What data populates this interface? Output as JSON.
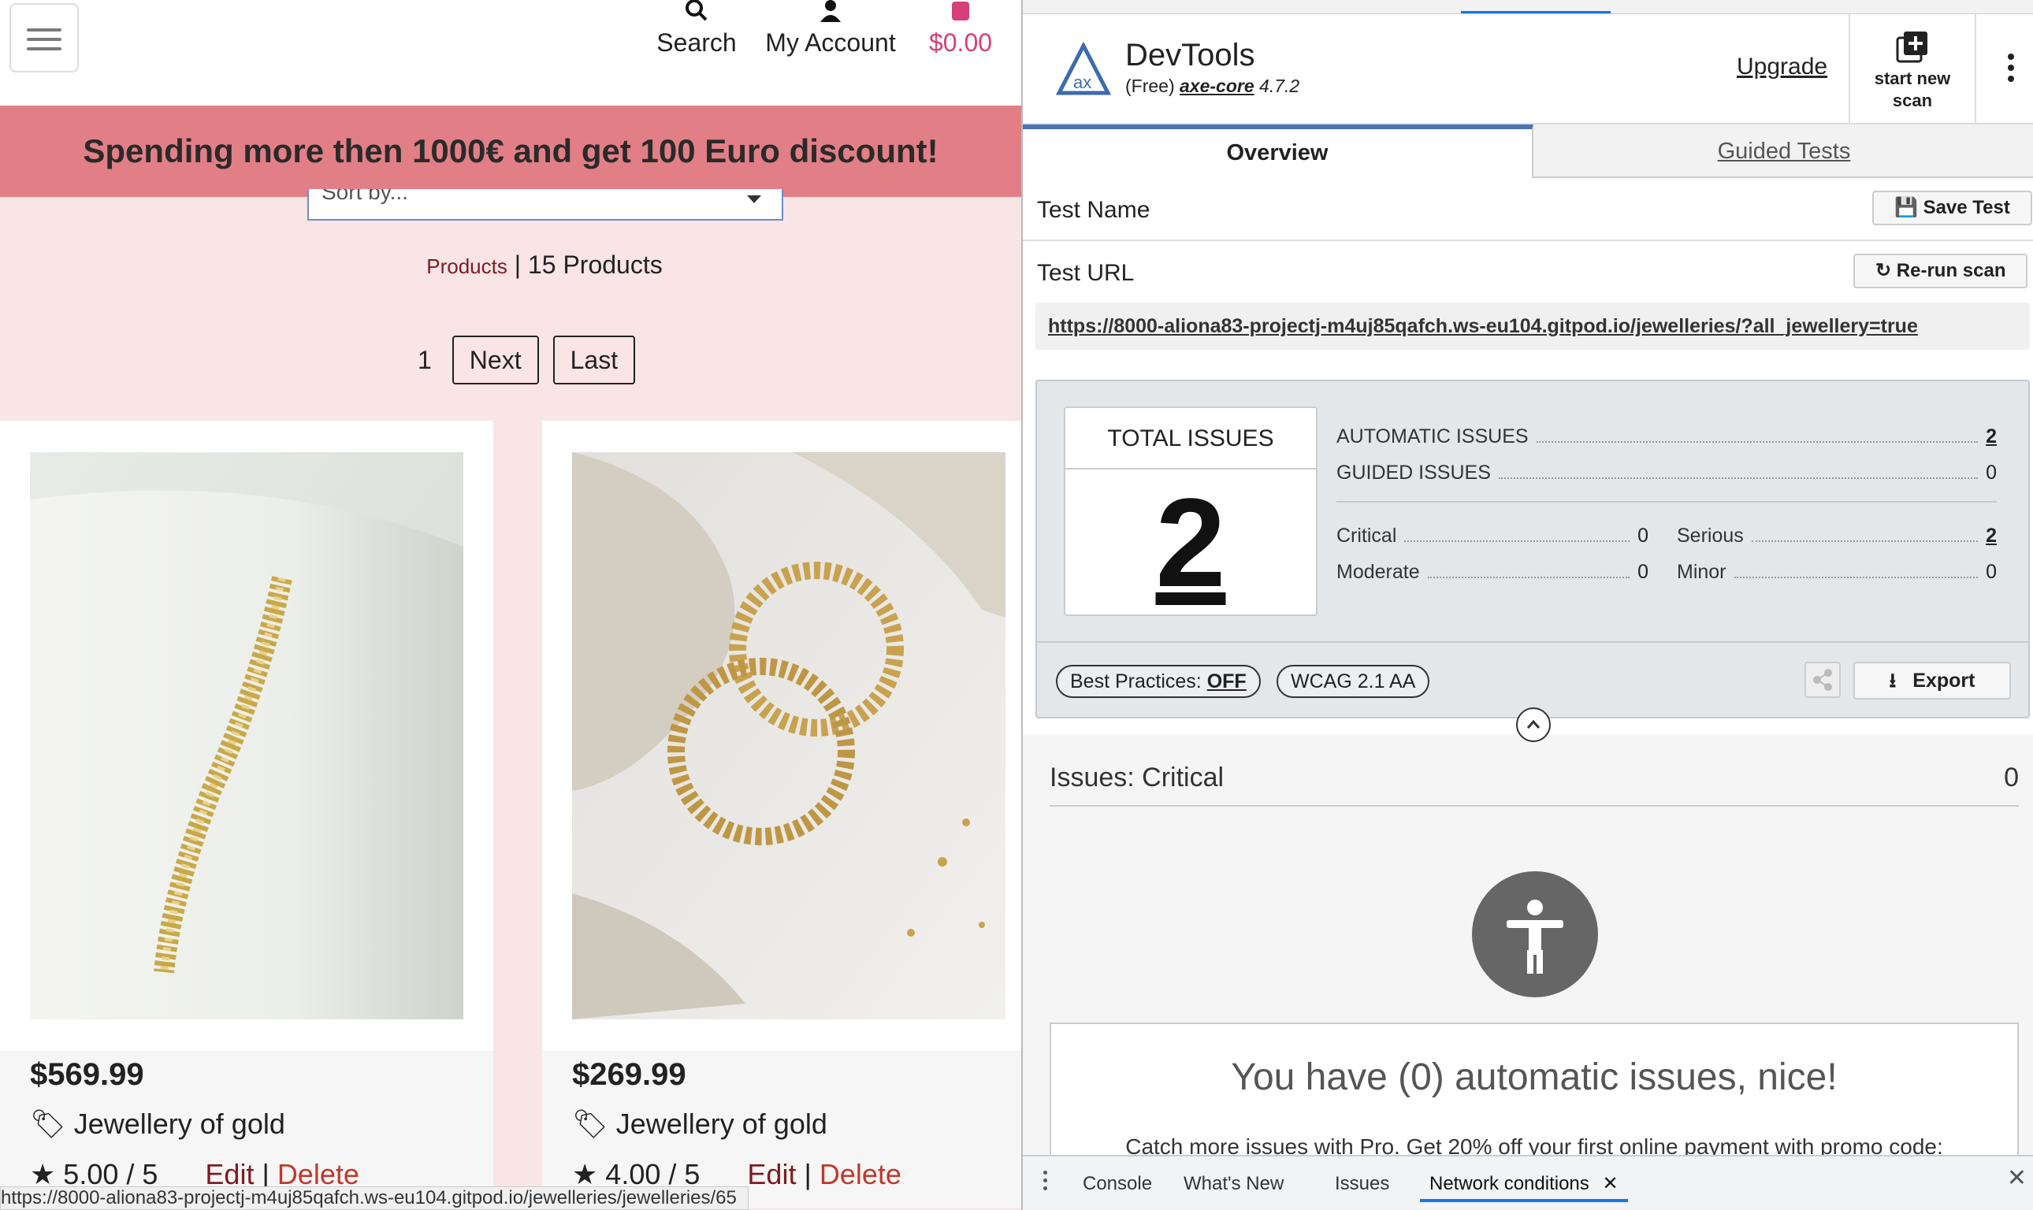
{
  "site": {
    "header": {
      "search_label": "Search",
      "account_label": "My Account",
      "cart_total": "$0.00"
    },
    "banner": "Spending more then 1000€ and get 100 Euro discount!",
    "sort_placeholder": "Sort by...",
    "products_link": "Products",
    "products_separator": " | ",
    "products_count": "15 Products",
    "pagination": {
      "current_page": "1",
      "next_label": "Next",
      "last_label": "Last"
    },
    "products": [
      {
        "price": "$569.99",
        "category": "Jewellery of gold",
        "rating": "5.00 / 5",
        "edit": "Edit",
        "sep": " | ",
        "delete": "Delete"
      },
      {
        "price": "$269.99",
        "category": "Jewellery of gold",
        "rating": "4.00 / 5",
        "edit": "Edit",
        "sep": " | ",
        "delete": "Delete"
      }
    ],
    "status_url": "https://8000-aliona83-projectj-m4uj85qafch.ws-eu104.gitpod.io/jewelleries/jewelleries/65",
    "colors": {
      "banner": "#e27f86",
      "background": "#f9e4e6",
      "cart": "#d63f79"
    }
  },
  "devtools": {
    "title": "DevTools",
    "subtitle_free": "(Free)",
    "subtitle_core": "axe-core",
    "subtitle_version": "4.7.2",
    "upgrade_label": "Upgrade",
    "new_scan_label": "start new scan",
    "tabs": {
      "overview": "Overview",
      "guided": "Guided Tests"
    },
    "test_name_label": "Test Name",
    "save_test_label": "Save Test",
    "test_url_label": "Test URL",
    "rerun_label": "Re-run scan",
    "test_url": "https://8000-aliona83-projectj-m4uj85qafch.ws-eu104.gitpod.io/jewelleries/?all_jewellery=true",
    "summary": {
      "total_label": "TOTAL ISSUES",
      "total_value": "2",
      "automatic_label": "AUTOMATIC ISSUES",
      "automatic_value": "2",
      "guided_label": "GUIDED ISSUES",
      "guided_value": "0",
      "critical_label": "Critical",
      "critical_value": "0",
      "serious_label": "Serious",
      "serious_value": "2",
      "moderate_label": "Moderate",
      "moderate_value": "0",
      "minor_label": "Minor",
      "minor_value": "0",
      "best_practices_label": "Best Practices:",
      "best_practices_value": "OFF",
      "wcag_label": "WCAG 2.1 AA",
      "export_label": "Export"
    },
    "issues": {
      "title": "Issues: Critical",
      "count": "0",
      "nice_title": "You have (0) automatic issues, nice!",
      "nice_sub": "Catch more issues with Pro. Get 20% off your first online payment with promo code:"
    },
    "drawer_tabs": [
      "Console",
      "What's New",
      "Issues",
      "Network conditions"
    ],
    "colors": {
      "accent": "#4a74b5",
      "chrome_active": "#1a73e8"
    }
  }
}
